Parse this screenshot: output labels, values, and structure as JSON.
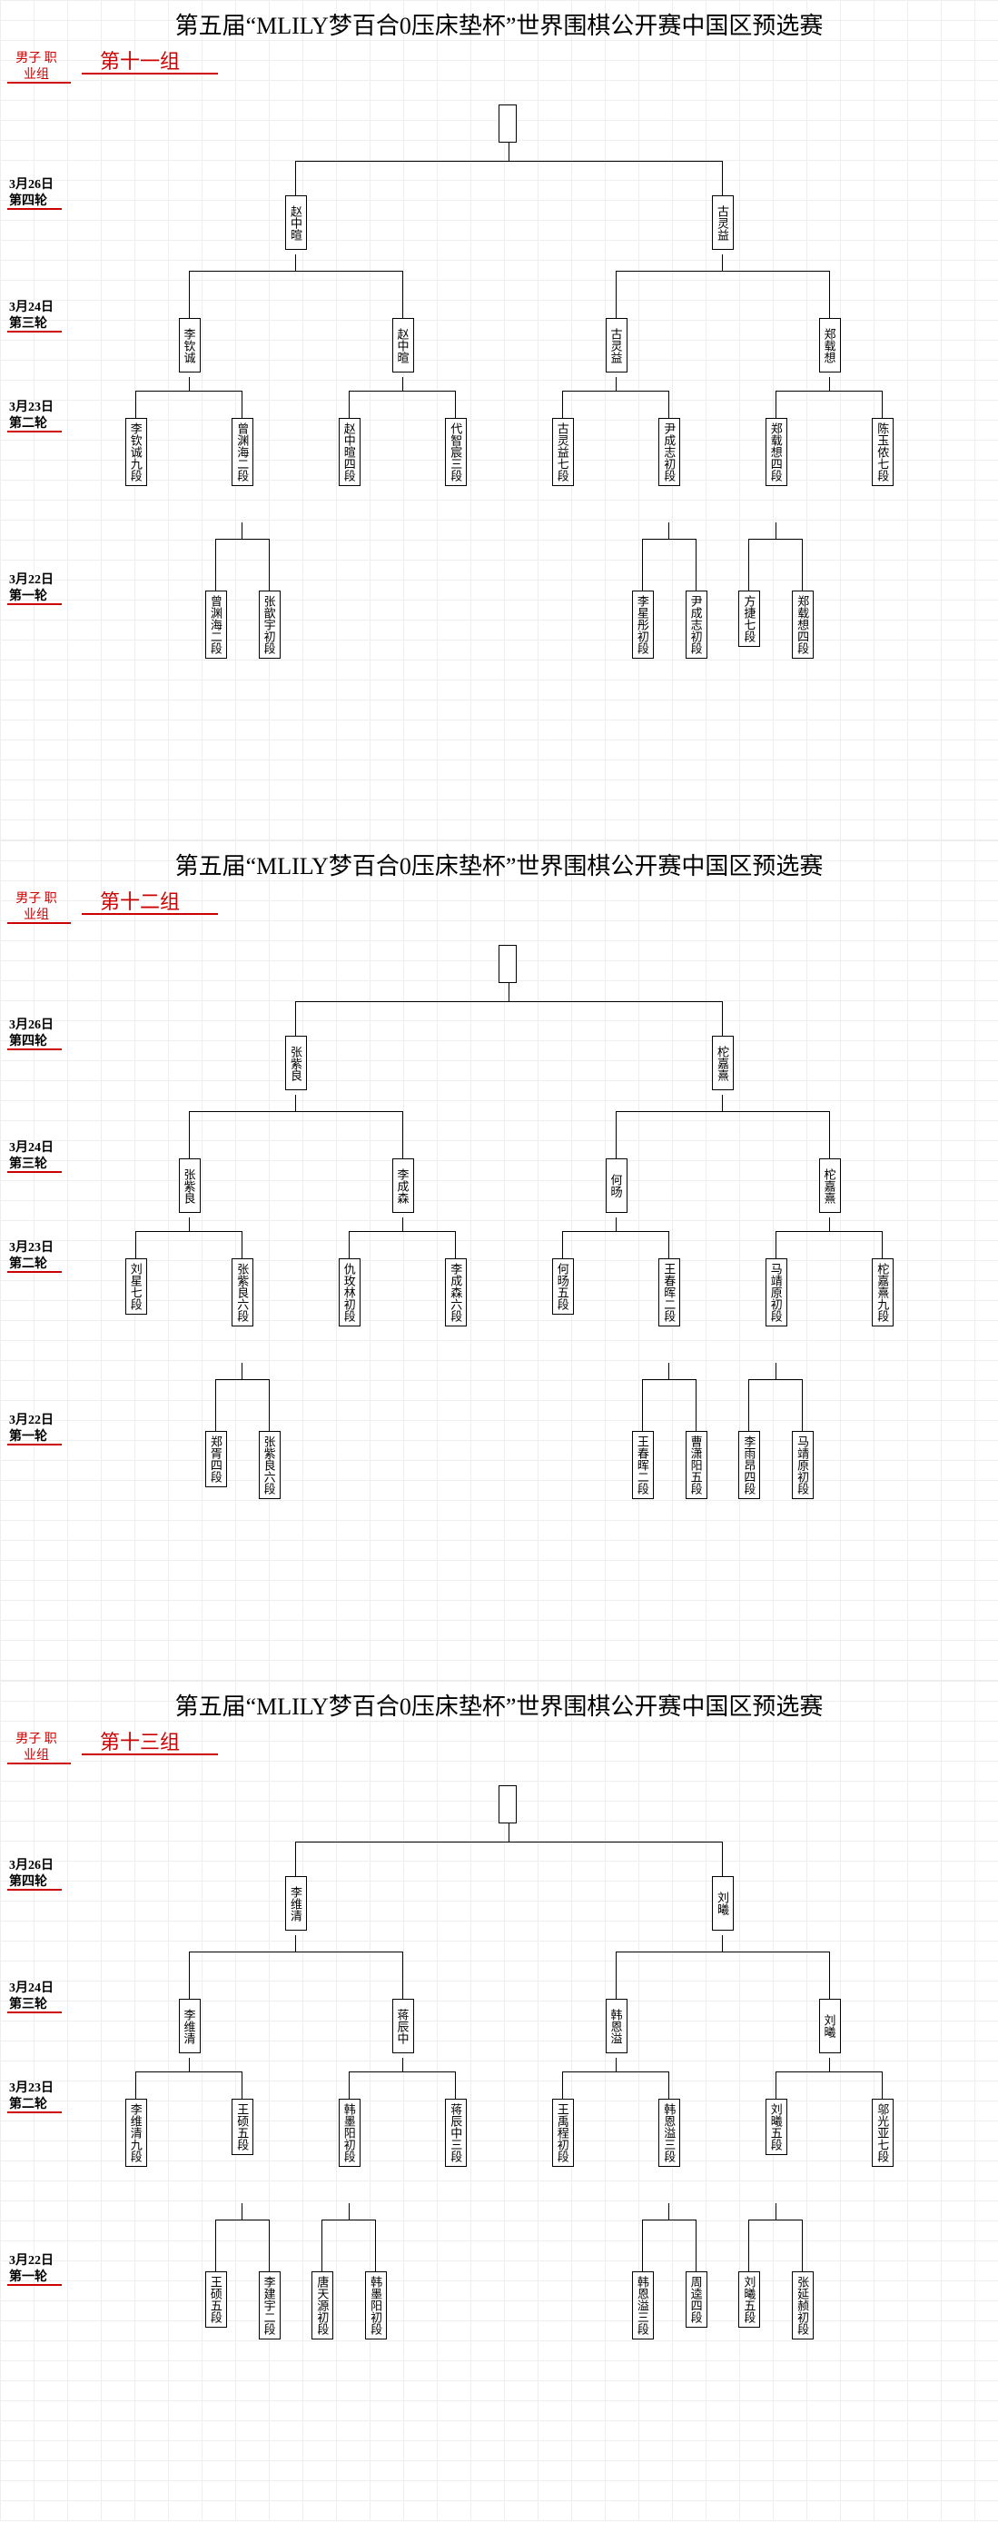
{
  "title": "第五届“MLILY梦百合0压床垫杯”世界围棋公开赛中国区预选赛",
  "category": "男子\n职业组",
  "rounds": [
    {
      "date": "3月26日",
      "name": "第四轮"
    },
    {
      "date": "3月24日",
      "name": "第三轮"
    },
    {
      "date": "3月23日",
      "name": "第二轮"
    },
    {
      "date": "3月22日",
      "name": "第一轮"
    }
  ],
  "brackets": [
    {
      "group": "第十一组",
      "r4": [
        "赵中暄",
        "古灵益"
      ],
      "r3": [
        "李钦诚",
        "赵中暄",
        "古灵益",
        "郑载想"
      ],
      "r2": [
        "李钦诚九段",
        "曾渊海二段",
        "赵中暄四段",
        "代智宸三段",
        "古灵益七段",
        "尹成志初段",
        "郑载想四段",
        "陈玉侬七段"
      ],
      "r1": [
        null,
        null,
        "曾渊海二段",
        "张歆宇初段",
        null,
        null,
        null,
        null,
        null,
        null,
        "李星彤初段",
        "尹成志初段",
        "方捷七段",
        "郑载想四段",
        null,
        null
      ]
    },
    {
      "group": "第十二组",
      "r4": [
        "张紫良",
        "柁嘉熹"
      ],
      "r3": [
        "张紫良",
        "李成森",
        "何旸",
        "柁嘉熹"
      ],
      "r2": [
        "刘星七段",
        "张紫良六段",
        "仇玫林初段",
        "李成森六段",
        "何旸五段",
        "王春晖二段",
        "马靖原初段",
        "柁嘉熹九段"
      ],
      "r1": [
        null,
        null,
        "郑胥四段",
        "张紫良六段",
        null,
        null,
        null,
        null,
        null,
        null,
        "王春晖二段",
        "曹潇阳五段",
        "李雨昂四段",
        "马靖原初段",
        null,
        null
      ]
    },
    {
      "group": "第十三组",
      "r4": [
        "李维清",
        "刘曦"
      ],
      "r3": [
        "李维清",
        "蒋辰中",
        "韩恩溢",
        "刘曦"
      ],
      "r2": [
        "李维清九段",
        "王硕五段",
        "韩墨阳初段",
        "蒋辰中三段",
        "王禹程初段",
        "韩恩溢三段",
        "刘曦五段",
        "邬光亚七段"
      ],
      "r1": [
        null,
        null,
        "王硕五段",
        "李建宇二段",
        "唐天源初段",
        "韩墨阳初段",
        null,
        null,
        null,
        null,
        "韩恩溢三段",
        "周逵四段",
        "刘曦五段",
        "张延赪初段",
        null,
        null
      ]
    }
  ]
}
